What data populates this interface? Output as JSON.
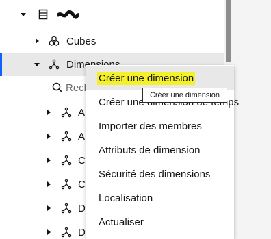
{
  "tree": {
    "root_label": "",
    "cubes_label": "Cubes",
    "dimensions_label": "Dimensions",
    "search_placeholder": "Rech",
    "children": [
      "A",
      "A",
      "C",
      "C",
      "D",
      "D"
    ]
  },
  "context_menu": {
    "items": [
      "Créer une dimension",
      "Créer une dimension de temps",
      "Importer des membres",
      "Attributs de dimension",
      "Sécurité des dimensions",
      "Localisation",
      "Actualiser"
    ],
    "highlight_color": "#f4f02a"
  },
  "tooltip": {
    "text": "Créer une dimension"
  },
  "colors": {
    "accent": "#0f62fe",
    "selected_bg": "#e8e8e8"
  }
}
